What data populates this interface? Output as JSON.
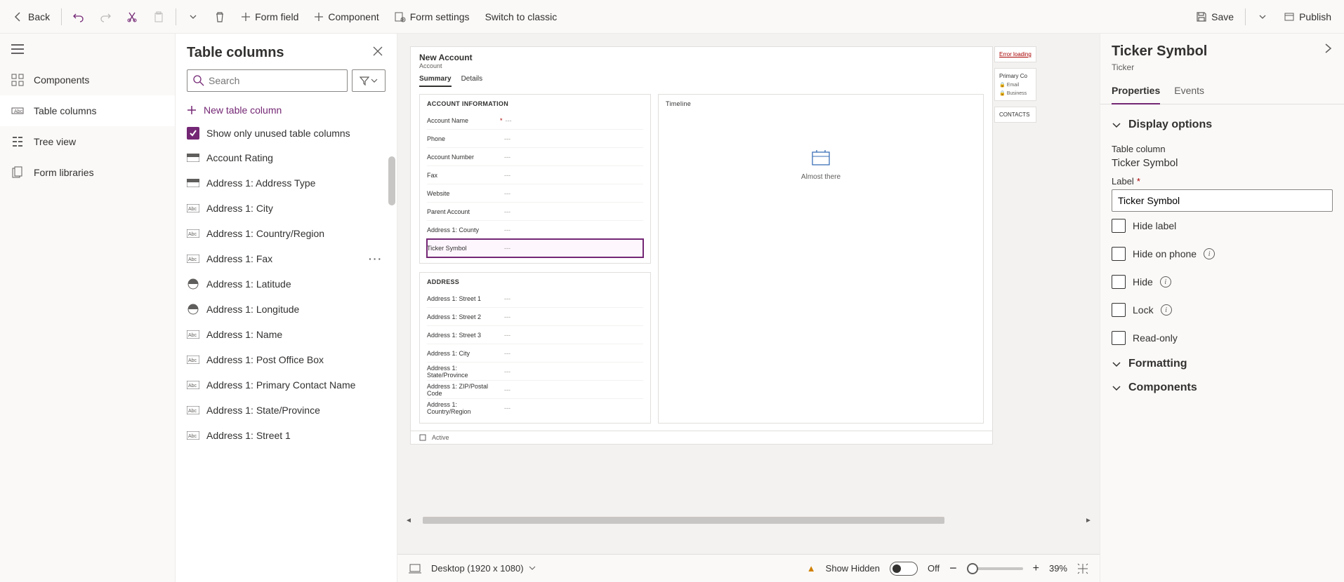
{
  "toolbar": {
    "back": "Back",
    "formField": "Form field",
    "component": "Component",
    "formSettings": "Form settings",
    "switchClassic": "Switch to classic",
    "save": "Save",
    "publish": "Publish"
  },
  "rail": {
    "components": "Components",
    "tableColumns": "Table columns",
    "treeView": "Tree view",
    "formLibraries": "Form libraries"
  },
  "columnsPanel": {
    "title": "Table columns",
    "searchPlaceholder": "Search",
    "newColumn": "New table column",
    "showUnused": "Show only unused table columns",
    "items": [
      {
        "label": "Account Rating",
        "type": "option"
      },
      {
        "label": "Address 1: Address Type",
        "type": "option"
      },
      {
        "label": "Address 1: City",
        "type": "text"
      },
      {
        "label": "Address 1: Country/Region",
        "type": "text"
      },
      {
        "label": "Address 1: Fax",
        "type": "text",
        "more": true
      },
      {
        "label": "Address 1: Latitude",
        "type": "float"
      },
      {
        "label": "Address 1: Longitude",
        "type": "float"
      },
      {
        "label": "Address 1: Name",
        "type": "text"
      },
      {
        "label": "Address 1: Post Office Box",
        "type": "text"
      },
      {
        "label": "Address 1: Primary Contact Name",
        "type": "text"
      },
      {
        "label": "Address 1: State/Province",
        "type": "text"
      },
      {
        "label": "Address 1: Street 1",
        "type": "text"
      }
    ]
  },
  "preview": {
    "title": "New Account",
    "subtitle": "Account",
    "tabs": {
      "summary": "Summary",
      "details": "Details"
    },
    "section1": {
      "title": "ACCOUNT INFORMATION",
      "fields": [
        {
          "label": "Account Name",
          "required": true,
          "value": "---"
        },
        {
          "label": "Phone",
          "value": "---"
        },
        {
          "label": "Account Number",
          "value": "---"
        },
        {
          "label": "Fax",
          "value": "---"
        },
        {
          "label": "Website",
          "value": "---"
        },
        {
          "label": "Parent Account",
          "value": "---"
        },
        {
          "label": "Address 1: County",
          "value": "---"
        },
        {
          "label": "Ticker Symbol",
          "value": "---",
          "selected": true
        }
      ]
    },
    "section2": {
      "title": "ADDRESS",
      "fields": [
        {
          "label": "Address 1: Street 1",
          "value": "---"
        },
        {
          "label": "Address 1: Street 2",
          "value": "---"
        },
        {
          "label": "Address 1: Street 3",
          "value": "---"
        },
        {
          "label": "Address 1: City",
          "value": "---"
        },
        {
          "label": "Address 1: State/Province",
          "value": "---"
        },
        {
          "label": "Address 1: ZIP/Postal Code",
          "value": "---"
        },
        {
          "label": "Address 1: Country/Region",
          "value": "---"
        }
      ]
    },
    "timeline": {
      "title": "Timeline",
      "status": "Almost there"
    },
    "sideCards": {
      "errorLoading": "Error loading",
      "primaryContact": "Primary Co",
      "email": "Email",
      "business": "Business",
      "contacts": "CONTACTS"
    },
    "footerStatus": "Active"
  },
  "canvasBar": {
    "device": "Desktop (1920 x 1080)",
    "showHidden": "Show Hidden",
    "toggleState": "Off",
    "zoom": "39%"
  },
  "props": {
    "title": "Ticker Symbol",
    "subtitle": "Ticker",
    "tabs": {
      "properties": "Properties",
      "events": "Events"
    },
    "displayOptions": "Display options",
    "tableColumnLabel": "Table column",
    "tableColumnValue": "Ticker Symbol",
    "labelLabel": "Label",
    "labelValue": "Ticker Symbol",
    "hideLabel": "Hide label",
    "hideOnPhone": "Hide on phone",
    "hide": "Hide",
    "lock": "Lock",
    "readOnly": "Read-only",
    "formatting": "Formatting",
    "components": "Components"
  }
}
